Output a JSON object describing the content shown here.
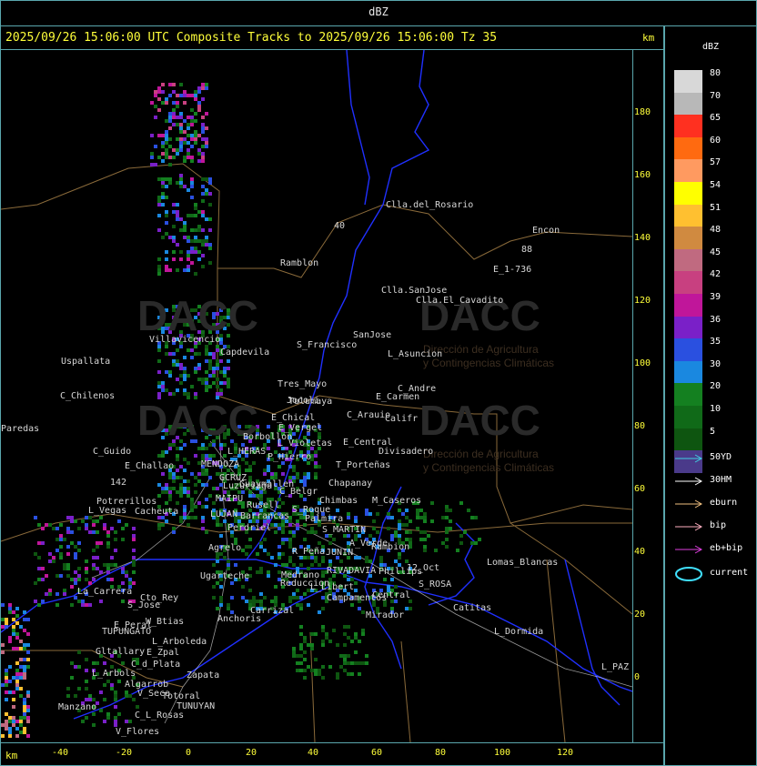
{
  "header": {
    "title": "dBZ"
  },
  "map_title": "2025/09/26 15:06:00 UTC Composite Tracks to 2025/09/26 15:06:00 Tz 35",
  "km_label": "km",
  "y_ticks": [
    "180",
    "160",
    "140",
    "120",
    "100",
    "80",
    "60",
    "40",
    "20",
    "0"
  ],
  "x_ticks": [
    "-40",
    "-20",
    "0",
    "20",
    "40",
    "60",
    "80",
    "100",
    "120"
  ],
  "legend": {
    "unit": "dBZ",
    "levels": [
      {
        "label": "80",
        "color": "#d8d8d8"
      },
      {
        "label": "70",
        "color": "#b8b8b8"
      },
      {
        "label": "65",
        "color": "#ff3020"
      },
      {
        "label": "60",
        "color": "#ff6a10"
      },
      {
        "label": "57",
        "color": "#ff9a60"
      },
      {
        "label": "54",
        "color": "#ffff00"
      },
      {
        "label": "51",
        "color": "#ffc030"
      },
      {
        "label": "48",
        "color": "#d08a40"
      },
      {
        "label": "45",
        "color": "#c06a80"
      },
      {
        "label": "42",
        "color": "#c84080"
      },
      {
        "label": "39",
        "color": "#c0169a"
      },
      {
        "label": "36",
        "color": "#7a20c8"
      },
      {
        "label": "35",
        "color": "#2a50e0"
      },
      {
        "label": "30",
        "color": "#1a88e0"
      },
      {
        "label": "20",
        "color": "#148020"
      },
      {
        "label": "10",
        "color": "#106a18"
      },
      {
        "label": "5",
        "color": "#0e5510"
      },
      {
        "label": "",
        "color": "#4a3a8a"
      }
    ],
    "tracks": [
      {
        "label": "50YD",
        "color": "#40d0e0"
      },
      {
        "label": "30HM",
        "color": "#ffffff"
      },
      {
        "label": "eburn",
        "color": "#f0c080"
      },
      {
        "label": "bip",
        "color": "#ffb0c0"
      },
      {
        "label": "eb+bip",
        "color": "#e040e0"
      },
      {
        "label": "current",
        "color": "#40e0ff"
      }
    ]
  },
  "watermark": {
    "brand": "DACC",
    "subtitle_1": "Dirección de Agricultura",
    "subtitle_2": "y Contingencias Climáticas"
  },
  "places": [
    "Clla.del_Rosario",
    "Encon",
    "E_1-736",
    "Ramblon",
    "Clla.SanJose",
    "Clla.El_Cavadito",
    "Villavicencio",
    "Capdevila",
    "Uspallata",
    "S_Francisco",
    "SanJose",
    "L_Asuncion",
    "Tres_Mayo",
    "Jocoli",
    "C_Chilenos",
    "Tulumaya",
    "E_Carmen",
    "C_Andre",
    "E_Chical",
    "E_Vergel",
    "C_Arauio",
    "Califr",
    "Paredas",
    "Borbollon",
    "L_Violetas",
    "E_Central",
    "Divisadero",
    "C_Guido",
    "L_HERAS",
    "P_Hierro",
    "E_Challao",
    "MENDOZA",
    "T_Porteñas",
    "GCRUZ",
    "Guaymallen",
    "C_Belgr",
    "Chapanay",
    "Luzuriaga",
    "Chimbas",
    "M_Caseros",
    "Potrerillos",
    "Cacheuta",
    "MAIPU",
    "Rusell",
    "S_Roque",
    "L_Vegas",
    "LUJAN",
    "Barrancas",
    "Palmira",
    "Perdriel",
    "S_MARTIN",
    "Agrelo",
    "R_Peña",
    "JUNIN",
    "A_Verde",
    "Rambion",
    "Ugarteche",
    "Medrano",
    "RIVADAVIA",
    "Phillips",
    "12_Oct",
    "Lomas_Blancas",
    "La_Carrera",
    "Cto_Rey",
    "Reduccion",
    "L_Libert",
    "S_ROSA",
    "S_Jose",
    "Campamentos",
    "Central",
    "Catitas",
    "W_Btias",
    "Carrizal",
    "E_Peral",
    "Anchoris",
    "Mirador",
    "TUPUNGATO",
    "L_Dormida",
    "Gltallary",
    "E_Zpal",
    "L_Arboleda",
    "C_d_Plata",
    "L_Arbols",
    "Zapata",
    "L_PAZ",
    "Algarrob",
    "V_Seca",
    "Totoral",
    "TUNUYAN",
    "Manzano",
    "C_L_Rosas",
    "V_Flores",
    "142",
    "40",
    "88"
  ]
}
